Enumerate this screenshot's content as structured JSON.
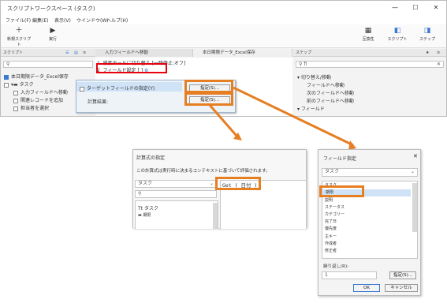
{
  "window": {
    "title": "スクリプトワークスペース (タスク)",
    "controls": [
      "—",
      "☐",
      "✕"
    ]
  },
  "menu": [
    "ファイル(F)",
    "編集(E)",
    "表示(V)",
    "ウインドウ(W)",
    "ヘルプ(H)"
  ],
  "toolbar": {
    "new_script": "新規スクリプト",
    "run": "実行",
    "compat": "互換性",
    "script": "スクリプト",
    "step": "ステップ"
  },
  "left": {
    "header": "スクリプト",
    "search_icon": "search-icon",
    "items": [
      {
        "label": "本日期限データ_Excel保存",
        "checked": true
      },
      {
        "label": "タスク",
        "folder": true
      },
      {
        "label": "入力フィールドへ移動"
      },
      {
        "label": "関連レコードを追加"
      },
      {
        "label": "担当者を選択"
      }
    ]
  },
  "tabs": [
    {
      "label": "入力フィールドへ移動"
    },
    {
      "label": "本日期限データ_Excel保存"
    }
  ],
  "steps": [
    {
      "num": "1",
      "text": "検索モードに切り替え [一時停止:オフ]"
    },
    {
      "num": "2",
      "text": "フィールド設定 [ ]"
    }
  ],
  "popup": {
    "target_label": "ターゲットフィールドの指定(Y)",
    "calc_label": "計算結果:",
    "spec_button": "指定(S)...",
    "spec_button2": "指定(S)..."
  },
  "right": {
    "header": "ステップ",
    "search_value": "fi",
    "items": [
      {
        "label": "切り替え/移動",
        "group": true
      },
      {
        "label": "フィールドへ移動"
      },
      {
        "label": "次のフィールドへ移動"
      },
      {
        "label": "前のフィールドへ移動"
      },
      {
        "label": "フィールド",
        "group": true
      }
    ]
  },
  "calc_dialog": {
    "title": "計算式の指定",
    "description": "この計算式は実行時に決まるコンテキストに基づいて評価されます。",
    "table_select": "タスク",
    "formula": "Get ( 日付 )",
    "list_items": [
      "タスク",
      "期限"
    ]
  },
  "field_dialog": {
    "title": "フィールド指定",
    "table_select": "タスク",
    "fields": [
      "タスク",
      "期限",
      "説明",
      "ステータス",
      "カテゴリー",
      "完了日",
      "優先度",
      "主キー",
      "作成者",
      "修正者"
    ],
    "repetition_label": "繰り返し(R):",
    "repetition_value": "1",
    "spec_button": "指定(S)...",
    "ok": "OK",
    "cancel": "キャンセル"
  },
  "colors": {
    "highlight": "#e67e22",
    "error": "#e8000e",
    "accent": "#3b78d0"
  }
}
